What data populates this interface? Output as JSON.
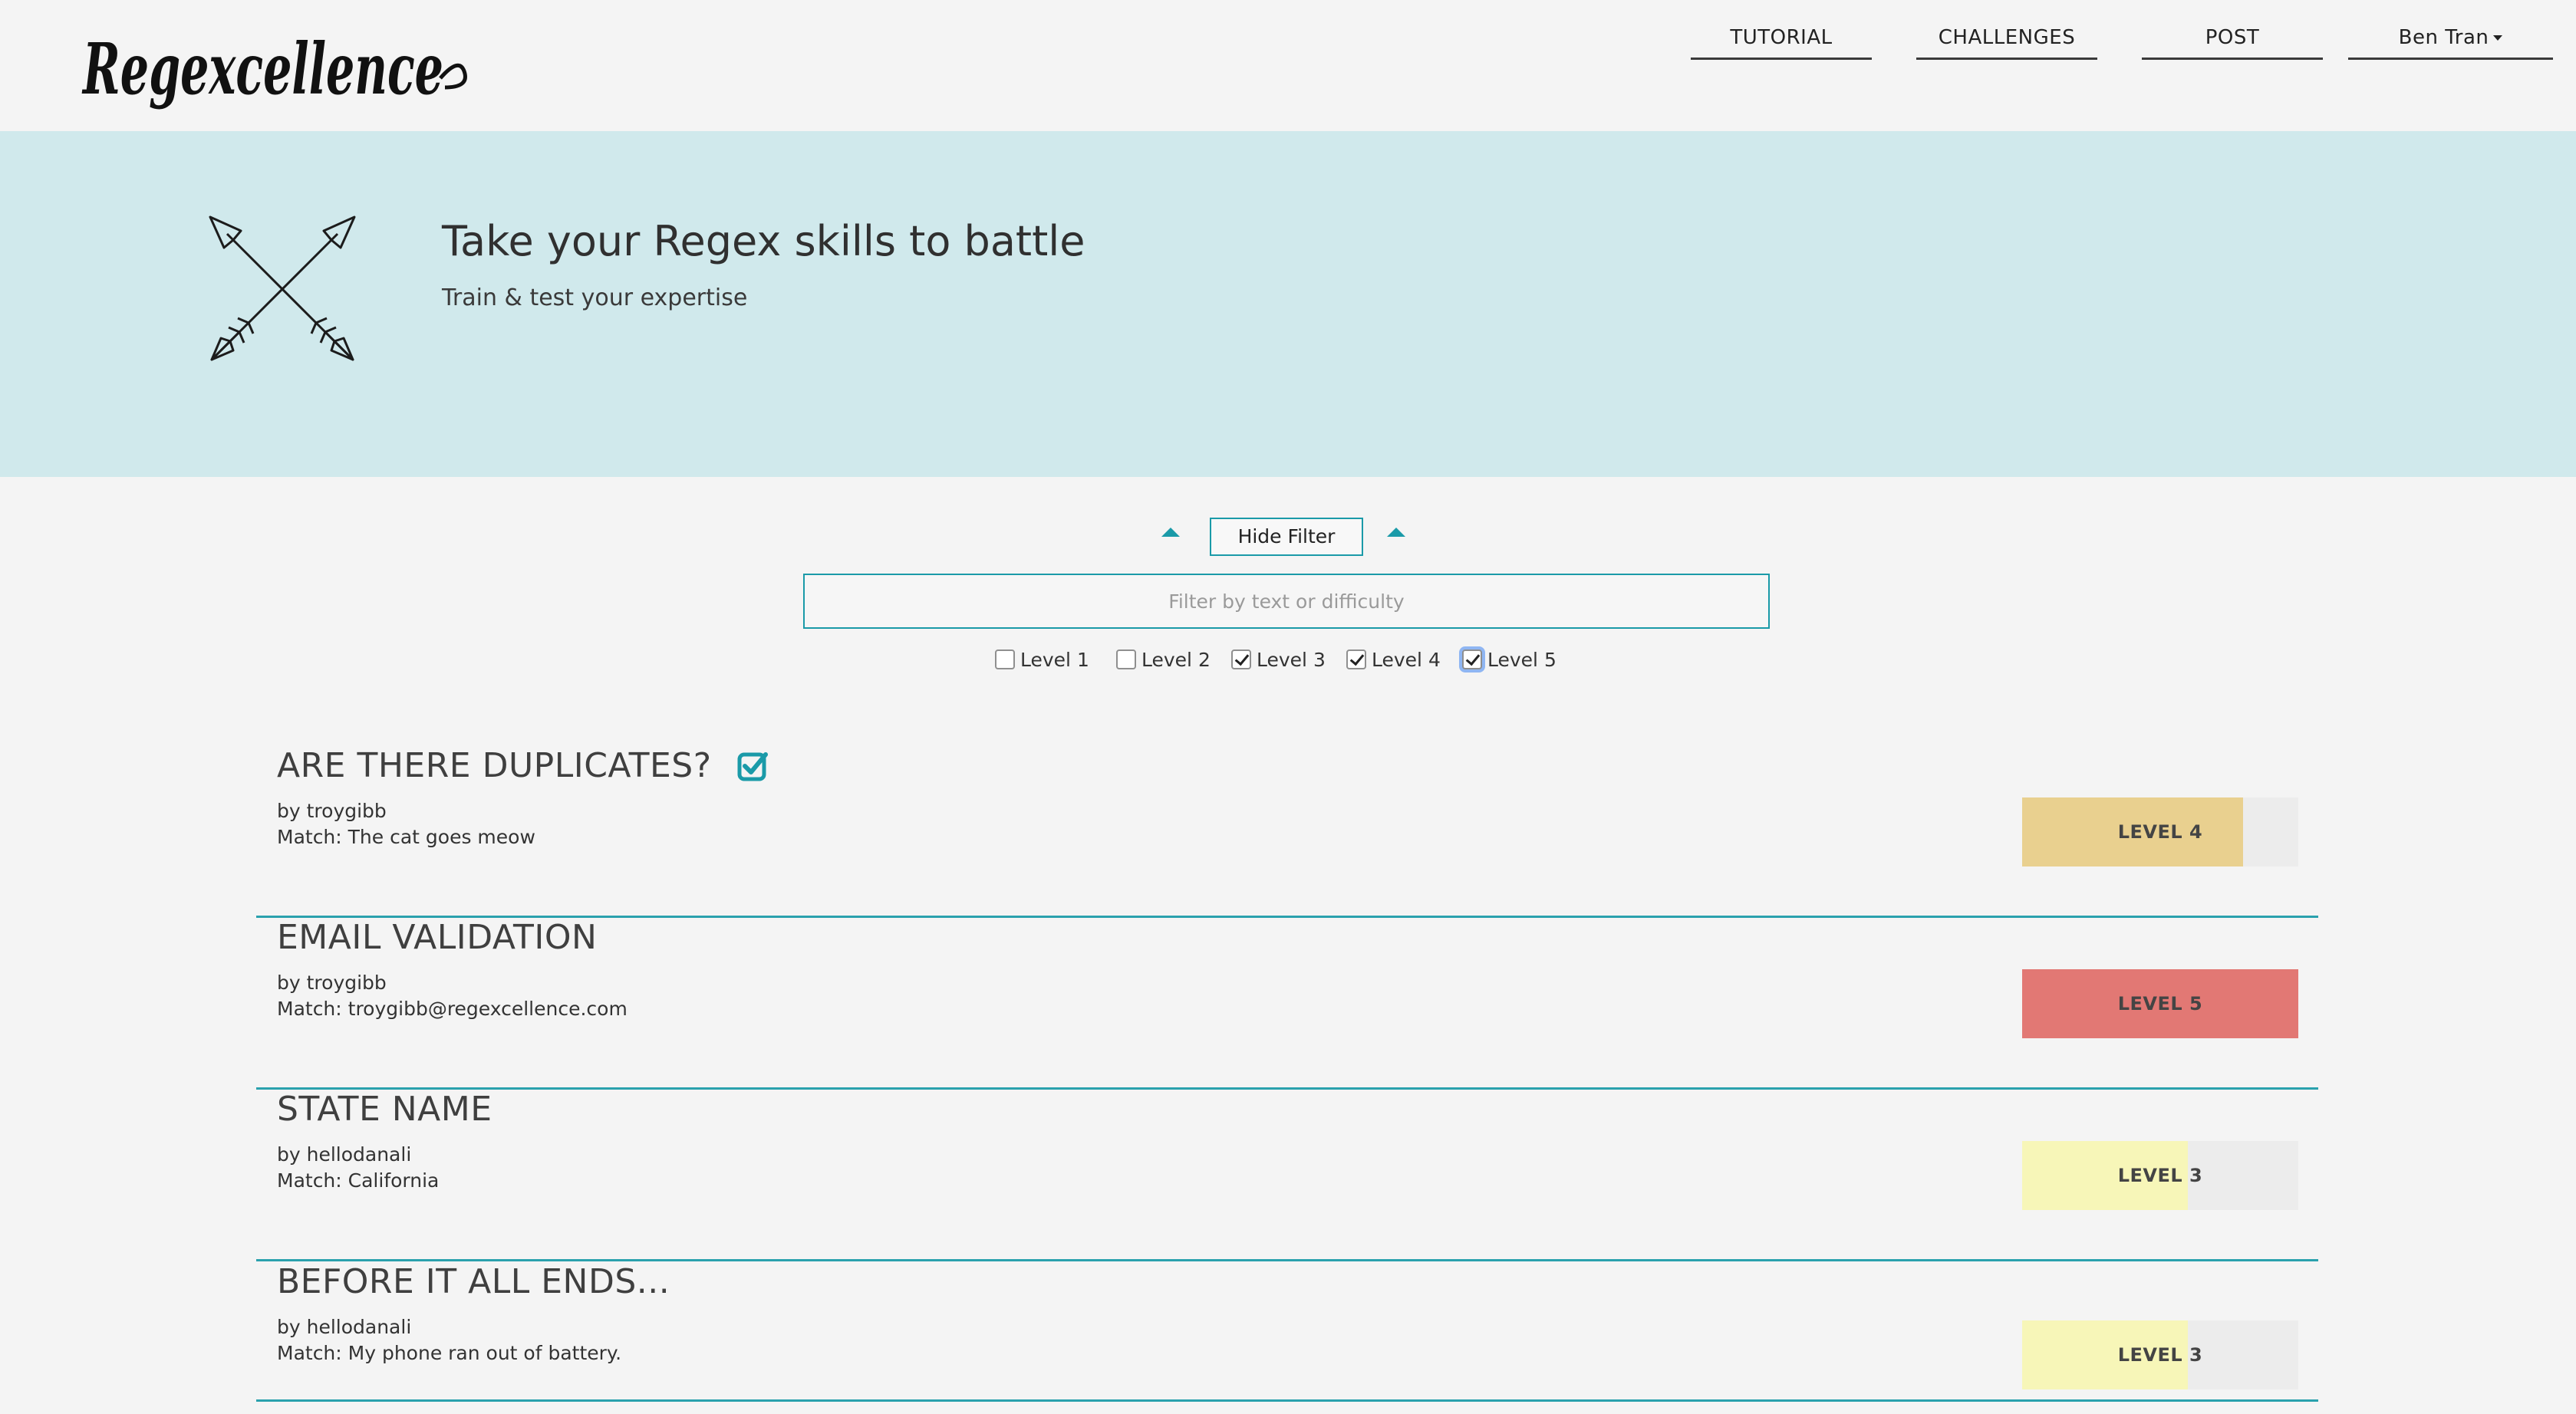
{
  "header": {
    "logo_text": "Regexcellence",
    "nav": {
      "tutorial": "TUTORIAL",
      "challenges": "CHALLENGES",
      "post": "POST",
      "user": "Ben Tran"
    }
  },
  "banner": {
    "title": "Take your Regex skills to battle",
    "subtitle": "Train & test your expertise",
    "icon": "crossed-arrows-icon"
  },
  "filter": {
    "toggle_label": "Hide Filter",
    "placeholder": "Filter by text or difficulty",
    "value": "",
    "levels": [
      {
        "label": "Level 1",
        "checked": false
      },
      {
        "label": "Level 2",
        "checked": false
      },
      {
        "label": "Level 3",
        "checked": true
      },
      {
        "label": "Level 4",
        "checked": true
      },
      {
        "label": "Level 5",
        "checked": true
      }
    ]
  },
  "challenges": [
    {
      "title": "ARE THERE DUPLICATES?",
      "completed": true,
      "author": "by troygibb",
      "match": "Match: The cat goes meow",
      "level_label": "LEVEL 4",
      "level_fraction": 0.8,
      "level_color": "#e9d08f"
    },
    {
      "title": "EMAIL VALIDATION",
      "completed": false,
      "author": "by troygibb",
      "match": "Match: troygibb@regexcellence.com",
      "level_label": "LEVEL 5",
      "level_fraction": 1.0,
      "level_color": "#e27874"
    },
    {
      "title": "STATE NAME",
      "completed": false,
      "author": "by hellodanali",
      "match": "Match: California",
      "level_label": "LEVEL 3",
      "level_fraction": 0.6,
      "level_color": "#f7f6b8"
    },
    {
      "title": "BEFORE IT ALL ENDS...",
      "completed": false,
      "author": "by hellodanali",
      "match": "Match: My phone ran out of battery.",
      "level_label": "LEVEL 3",
      "level_fraction": 0.6,
      "level_color": "#f7f6b8"
    }
  ],
  "colors": {
    "accent": "#1a9aa8",
    "banner_bg": "#d0e9ec",
    "page_bg": "#f4f4f4"
  }
}
